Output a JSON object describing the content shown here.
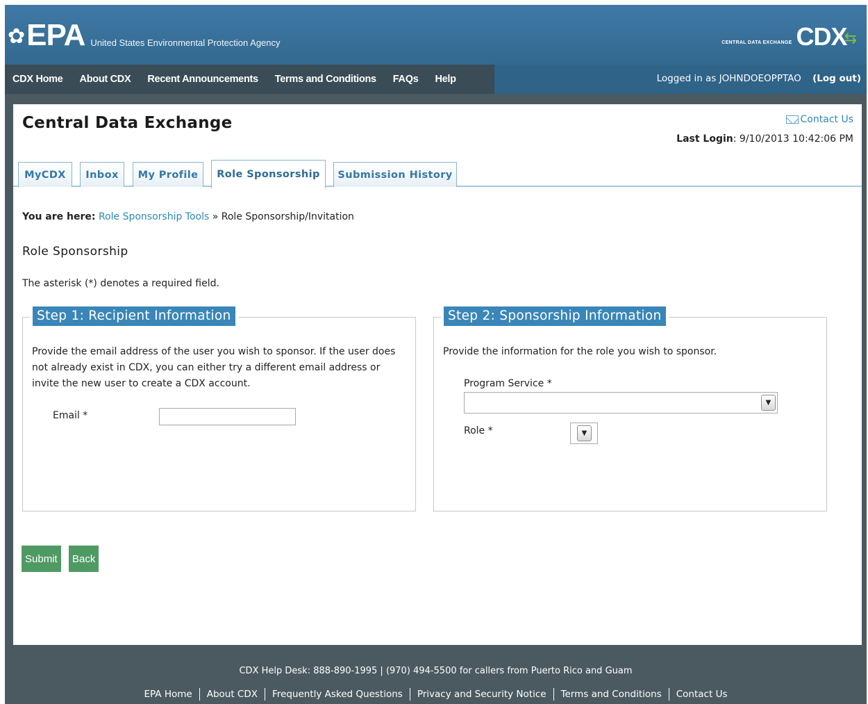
{
  "header": {
    "epa_wordmark": "EPA",
    "agency_name": "United States Environmental Protection Agency",
    "cdx_tagline": "CENTRAL DATA EXCHANGE",
    "cdx_wordmark": "CDX"
  },
  "nav": {
    "items": [
      "CDX Home",
      "About CDX",
      "Recent Announcements",
      "Terms and Conditions",
      "FAQs",
      "Help"
    ],
    "logged_in_text": "Logged in as JOHNDOEOPPTAO",
    "logout_label": "(Log out)"
  },
  "page": {
    "site_title": "Central Data Exchange",
    "contact_label": "Contact Us",
    "last_login_label": "Last Login",
    "last_login_value": ": 9/10/2013 10:42:06 PM"
  },
  "tabs": [
    {
      "label": "MyCDX",
      "active": false
    },
    {
      "label": "Inbox",
      "active": false
    },
    {
      "label": "My Profile",
      "active": false
    },
    {
      "label": "Role Sponsorship",
      "active": true
    },
    {
      "label": "Submission History",
      "active": false
    }
  ],
  "breadcrumb": {
    "prefix": "You are here:",
    "link": "Role Sponsorship Tools",
    "separator": "»",
    "current": "Role Sponsorship/Invitation"
  },
  "main": {
    "heading": "Role Sponsorship",
    "required_note": "The asterisk (*) denotes a required field."
  },
  "step1": {
    "legend": "Step 1: Recipient Information",
    "description": "Provide the email address of the user you wish to sponsor. If the user does not already exist in CDX, you can either try a different email address or invite the new user to create a CDX account.",
    "email_label": "Email *",
    "email_value": ""
  },
  "step2": {
    "legend": "Step 2: Sponsorship Information",
    "description": "Provide the information for the role you wish to sponsor.",
    "program_service_label": "Program Service *",
    "program_service_value": "",
    "role_label": "Role *",
    "role_value": ""
  },
  "buttons": {
    "submit": "Submit",
    "back": "Back"
  },
  "footer": {
    "help_desk": "CDX Help Desk: 888-890-1995 | (970) 494-5500 for callers from Puerto Rico and Guam",
    "links": [
      "EPA Home",
      "About CDX",
      "Frequently Asked Questions",
      "Privacy and Security Notice",
      "Terms and Conditions",
      "Contact Us"
    ]
  },
  "colors": {
    "header_blue": "#3a76a3",
    "nav_dark": "#3a4c56",
    "legend_blue": "#3a86b8",
    "button_green": "#4f9a63",
    "link_blue": "#2e88b8"
  }
}
